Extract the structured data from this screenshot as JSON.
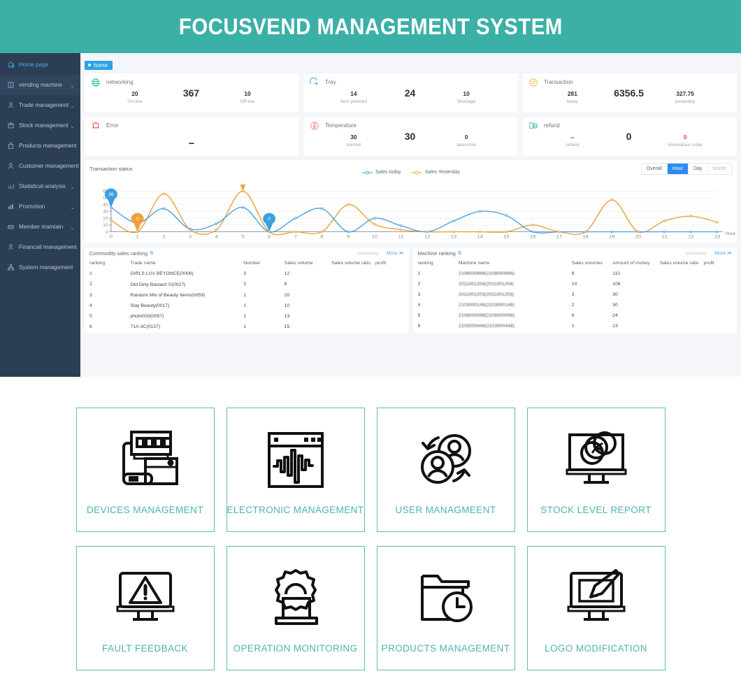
{
  "header": {
    "title": "FOCUSVEND MANAGEMENT SYSTEM",
    "bg": "#3bb0a6"
  },
  "sidebar": {
    "items": [
      {
        "label": "Home page",
        "icon": "home-icon",
        "caret": false,
        "active": true
      },
      {
        "label": "vending machine",
        "icon": "machine-icon",
        "caret": true,
        "active": false
      },
      {
        "label": "Trade management",
        "icon": "trade-icon",
        "caret": true,
        "active": false
      },
      {
        "label": "Stock management",
        "icon": "stock-icon",
        "caret": true,
        "active": false
      },
      {
        "label": "Products management",
        "icon": "products-icon",
        "caret": false,
        "active": false
      },
      {
        "label": "Customer management",
        "icon": "customer-icon",
        "caret": false,
        "active": false
      },
      {
        "label": "Statistical analysis",
        "icon": "chart-icon",
        "caret": true,
        "active": false
      },
      {
        "label": "Promotion",
        "icon": "promotion-icon",
        "caret": true,
        "active": false
      },
      {
        "label": "Member maintain",
        "icon": "member-icon",
        "caret": true,
        "active": false
      },
      {
        "label": "Financail management",
        "icon": "finance-icon",
        "caret": false,
        "active": false
      },
      {
        "label": "System management",
        "icon": "system-icon",
        "caret": false,
        "active": false
      }
    ]
  },
  "breadcrumb": {
    "label": "home"
  },
  "stats": [
    {
      "title": "networking",
      "icon": "globe-icon",
      "icon_color": "#2fbfa0",
      "main": "367",
      "left_num": "20",
      "left_label": "On-line",
      "right_num": "10",
      "right_label": "Off-line"
    },
    {
      "title": "Tray",
      "icon": "tray-icon",
      "icon_color": "#3aa5dd",
      "main": "24",
      "left_num": "14",
      "left_label": "Item jammed",
      "right_num": "10",
      "right_label": "Shortage"
    },
    {
      "title": "Transaction",
      "icon": "transaction-icon",
      "icon_color": "#f0c24b",
      "main": "6356.5",
      "left_num": "281",
      "left_label": "today",
      "right_num": "327.75",
      "right_label": "yesterday"
    },
    {
      "title": "Error",
      "icon": "alarm-icon",
      "icon_color": "#e8453c",
      "main": "--",
      "center_only": true,
      "left_num": "",
      "left_label": "",
      "right_num": "",
      "right_label": ""
    },
    {
      "title": "Temperature",
      "icon": "thermometer-icon",
      "icon_color": "#ef8585",
      "main": "30",
      "left_num": "30",
      "left_label": "normal",
      "right_num": "0",
      "right_label": "abnormal"
    },
    {
      "title": "refund",
      "icon": "refund-icon",
      "icon_color": "#2fbfa0",
      "main": "0",
      "left_num": "--",
      "left_label": "refund",
      "right_num": "0",
      "right_label": "Anomalous order",
      "right_red": true
    }
  ],
  "transaction_panel": {
    "title": "Transaction status",
    "tabs": [
      {
        "label": "Overall",
        "active": false
      },
      {
        "label": "Hour",
        "active": true
      },
      {
        "label": "Day",
        "active": false
      },
      {
        "label": "Month",
        "active": false
      }
    ]
  },
  "chart_data": {
    "type": "line",
    "title": "Transaction status",
    "xlabel": "Hour",
    "ylabel": "",
    "x": [
      0,
      1,
      2,
      3,
      4,
      5,
      6,
      7,
      8,
      9,
      10,
      11,
      12,
      13,
      14,
      15,
      16,
      17,
      18,
      19,
      20,
      21,
      22,
      23
    ],
    "xtick_labels": [
      "0",
      "1",
      "2",
      "3",
      "4",
      "5",
      "6",
      "7",
      "8",
      "9",
      "10",
      "11",
      "12",
      "13",
      "14",
      "15",
      "16",
      "17",
      "18",
      "19",
      "20",
      "21",
      "22",
      "23"
    ],
    "ytick_labels": [
      "0",
      "10",
      "20",
      "30",
      "40",
      "50",
      "60"
    ],
    "ylim": [
      0,
      62
    ],
    "grid": true,
    "legend": [
      "Sales today",
      "Sales Yesterday"
    ],
    "legend_position": "top-center",
    "colors": {
      "sales_today": "#4ba3e3",
      "sales_yesterday": "#e8a33d"
    },
    "series": [
      {
        "name": "Sales today",
        "color": "#4ba3e3",
        "values": [
          36,
          13,
          34,
          4,
          12,
          36,
          0,
          20,
          34,
          0,
          20,
          9,
          0,
          16,
          30,
          24,
          0,
          0,
          0,
          0,
          0,
          0,
          0,
          0
        ]
      },
      {
        "name": "Sales Yesterday",
        "color": "#e8a33d",
        "values": [
          17,
          0,
          56,
          3,
          3,
          59.75,
          0,
          0,
          0,
          40,
          11,
          3,
          0,
          0,
          0,
          0,
          10,
          0,
          0,
          47,
          0,
          16,
          23,
          14
        ]
      }
    ],
    "markers": [
      {
        "x": 0,
        "value": "36",
        "series": "Sales today",
        "color": "#3aa0e0"
      },
      {
        "x": 1,
        "value": "0",
        "series": "Sales Yesterday",
        "color": "#f2a03c"
      },
      {
        "x": 5,
        "value": "59.75",
        "series": "Sales Yesterday",
        "color": "#f2a03c"
      },
      {
        "x": 6,
        "value": "0",
        "series": "Sales today",
        "color": "#3aa0e0"
      }
    ]
  },
  "commodity_table": {
    "title": "Commodity sales ranking",
    "subtitle": "yesterday",
    "more": "More ≫",
    "columns": [
      "ranking",
      "Trade name",
      "Number",
      "Sales volume",
      "Sales volume ratio",
      "profit"
    ],
    "rows": [
      [
        "1",
        "GIRLS LUV BEYONCE(0006)",
        "3",
        "12",
        "",
        ""
      ],
      [
        "2",
        "Old Dirty Bastard ⊙(0027)",
        "2",
        "8",
        "",
        ""
      ],
      [
        "3",
        "Random Mix of Beauty Items(0059)",
        "1",
        "20",
        "",
        ""
      ],
      [
        "4",
        "Slay Beauty(0017)",
        "1",
        "10",
        "",
        ""
      ],
      [
        "5",
        "photo033(0057)",
        "1",
        "13",
        "",
        ""
      ],
      [
        "6",
        "71A-3C(0137)",
        "1",
        "15",
        "",
        ""
      ]
    ]
  },
  "machine_table": {
    "title": "Machine ranking",
    "subtitle": "yesterday",
    "more": "More ≫",
    "columns": [
      "ranking",
      "Machine name",
      "Sales volumes",
      "Amount of money",
      "Sales volume ratio",
      "profit"
    ],
    "rows": [
      [
        "1",
        "2108000666(2108000666)",
        "8",
        "110",
        "",
        ""
      ],
      [
        "2",
        "2011001204(2011001204)",
        "10",
        "106",
        "",
        ""
      ],
      [
        "3",
        "2011001203(2011001203)",
        "3",
        "30",
        "",
        ""
      ],
      [
        "4",
        "2103000146(2103000146)",
        "2",
        "30",
        "",
        ""
      ],
      [
        "5",
        "2108000098(2108000098)",
        "6",
        "24",
        "",
        ""
      ],
      [
        "6",
        "2103000448(2103000448)",
        "1",
        "13",
        "",
        ""
      ]
    ]
  },
  "features": [
    {
      "label": "DEVICES MANAGEMENT",
      "icon": "devices-icon"
    },
    {
      "label": "ELECTRONIC MANAGEMENT",
      "icon": "waveform-window-icon"
    },
    {
      "label": "USER MANAGMEENT",
      "icon": "users-sync-icon"
    },
    {
      "label": "STOCK LEVEL REPORT",
      "icon": "monitor-pie-icon"
    },
    {
      "label": "FAULT FEEDBACK",
      "icon": "monitor-warning-icon"
    },
    {
      "label": "OPERATION MONITORING",
      "icon": "gear-laptop-icon"
    },
    {
      "label": "PRODUCTS MANAGEMENT",
      "icon": "folder-clock-icon"
    },
    {
      "label": "LOGO MODIFICATION",
      "icon": "monitor-brush-icon"
    }
  ],
  "theme": {
    "teal": "#3bb0a6",
    "card_border": "#5cbdb4",
    "label": "#4fb3ac",
    "blue": "#2d8cf0"
  }
}
